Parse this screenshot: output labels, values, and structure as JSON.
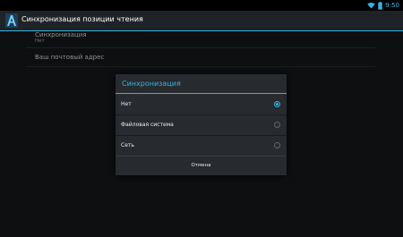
{
  "status_bar": {
    "time": "9:50"
  },
  "action_bar": {
    "title": "Синхронизация позиции чтения"
  },
  "preferences": [
    {
      "title": "Синхронизация",
      "summary": "Нет"
    },
    {
      "title": "Ваш почтовый адрес"
    }
  ],
  "dialog": {
    "title": "Синхронизация",
    "options": [
      {
        "label": "Нет",
        "checked": true
      },
      {
        "label": "Файловая система",
        "checked": false
      },
      {
        "label": "Сеть",
        "checked": false
      }
    ],
    "cancel_label": "Отмена"
  },
  "colors": {
    "accent": "#33b5e5",
    "background": "#151719",
    "dialog": "#272a2e"
  },
  "icons": [
    "app-icon",
    "wifi-icon",
    "battery-icon"
  ]
}
